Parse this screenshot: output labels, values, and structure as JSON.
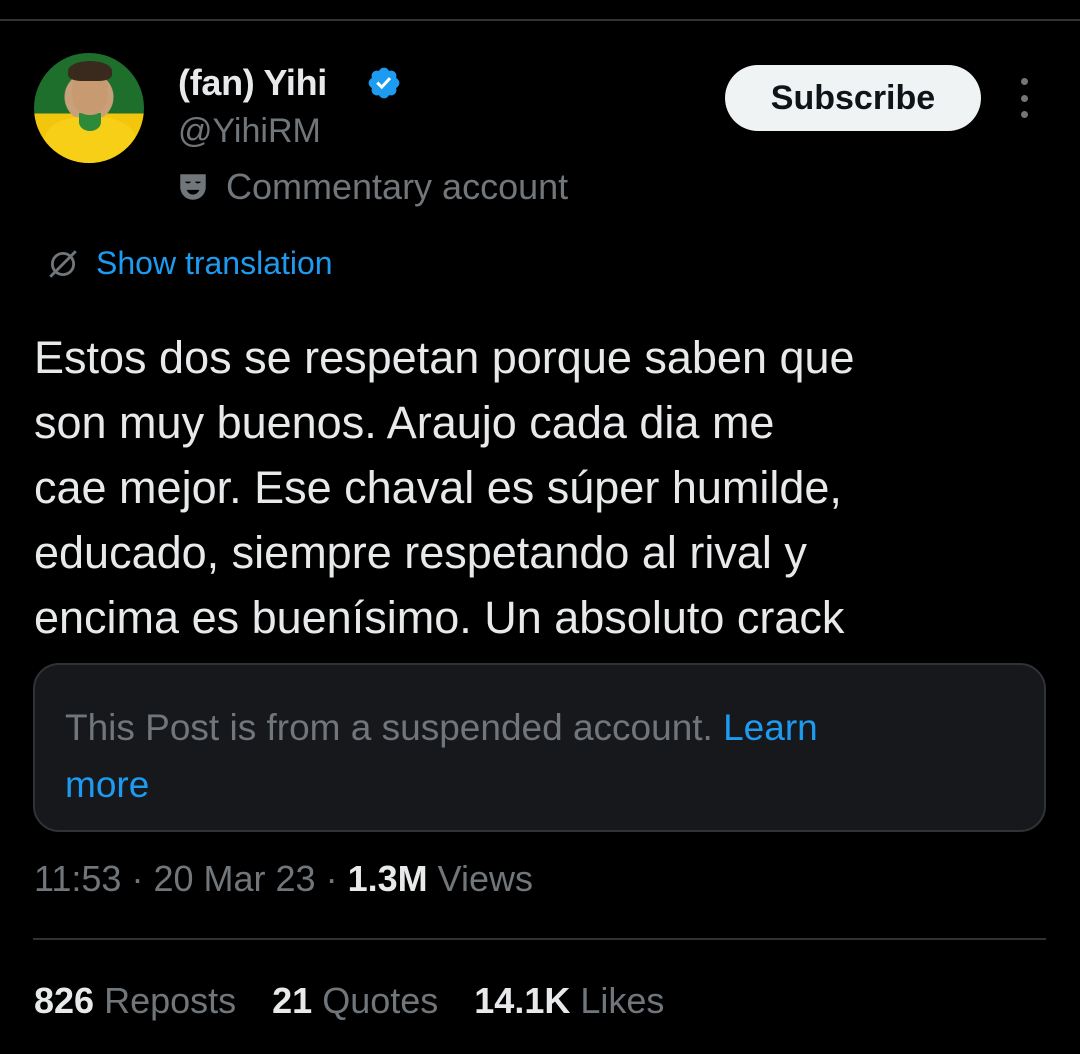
{
  "author": {
    "display_name": "(fan) Yihi",
    "handle": "@YihiRM",
    "label": "Commentary account"
  },
  "actions": {
    "subscribe_label": "Subscribe"
  },
  "translation": {
    "label": "Show translation"
  },
  "tweet": {
    "lines": [
      "Estos dos se respetan porque saben que",
      "son muy buenos. Araujo cada dia me",
      "cae mejor. Ese chaval es súper humilde,",
      "educado, siempre respetando al rival y",
      "encima es buenísimo. Un absoluto crack"
    ]
  },
  "notice": {
    "text_line1": "This Post is from a suspended account.",
    "link_part1": "Learn",
    "link_part2": "more"
  },
  "meta": {
    "time": "11:53",
    "separator": "·",
    "date": "20 Mar 23",
    "views_count": "1.3M",
    "views_label": "Views"
  },
  "stats": {
    "reposts_count": "826",
    "reposts_label": "Reposts",
    "quotes_count": "21",
    "quotes_label": "Quotes",
    "likes_count": "14.1K",
    "likes_label": "Likes"
  },
  "colors": {
    "background": "#000000",
    "text_primary": "#e7e9ea",
    "text_secondary": "#71767b",
    "accent_blue": "#1d9bf0",
    "card_background": "#16181c",
    "border": "#2f3336"
  },
  "icons": {
    "verified": "verified-badge-icon",
    "commentary": "theater-mask-icon",
    "translate": "globe-icon",
    "more": "more-vertical-icon"
  }
}
